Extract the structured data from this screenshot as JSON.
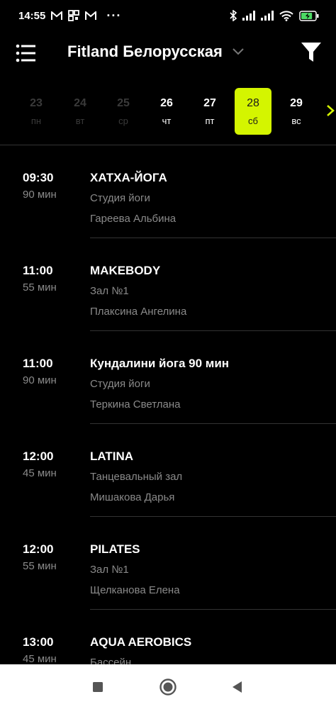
{
  "status_bar": {
    "time": "14:55",
    "left_icons": [
      "gmail-icon",
      "qr-grid-icon",
      "gmail-icon"
    ],
    "more": "···",
    "battery_level_percent": 80
  },
  "header": {
    "club_name": "Fitland Белорусская",
    "icons": {
      "menu": "menu-icon",
      "dropdown": "chevron-down-icon",
      "filter": "filter-icon"
    }
  },
  "dates": [
    {
      "day": "23",
      "dow": "пн",
      "state": "past"
    },
    {
      "day": "24",
      "dow": "вт",
      "state": "past"
    },
    {
      "day": "25",
      "dow": "ср",
      "state": "past"
    },
    {
      "day": "26",
      "dow": "чт",
      "state": "future"
    },
    {
      "day": "27",
      "dow": "пт",
      "state": "future"
    },
    {
      "day": "28",
      "dow": "сб",
      "state": "active"
    },
    {
      "day": "29",
      "dow": "вс",
      "state": "future"
    }
  ],
  "colors": {
    "accent": "#d4f500",
    "background": "#000000",
    "text_primary": "#ffffff",
    "text_secondary": "#8a8a8a",
    "past_date": "#3a3a3a",
    "divider": "#333333"
  },
  "sessions": [
    {
      "time": "09:30",
      "duration": "90 мин",
      "name": "ХАТХА-ЙОГА",
      "room": "Студия йоги",
      "trainer": "Гареева  Альбина"
    },
    {
      "time": "11:00",
      "duration": "55 мин",
      "name": "MAKEBODY",
      "room": "Зал №1",
      "trainer": "Плаксина Ангелина"
    },
    {
      "time": "11:00",
      "duration": "90 мин",
      "name": "Кундалини йога 90 мин",
      "room": "Студия йоги",
      "trainer": "Теркина Светлана"
    },
    {
      "time": "12:00",
      "duration": "45 мин",
      "name": "LATINA",
      "room": "Танцевальный зал",
      "trainer": "Мишакова Дарья"
    },
    {
      "time": "12:00",
      "duration": "55 мин",
      "name": "PILATES",
      "room": "Зал №1",
      "trainer": "Щелканова Елена"
    },
    {
      "time": "13:00",
      "duration": "45 мин",
      "name": "AQUA AEROBICS",
      "room": "Бассейн",
      "trainer": ""
    }
  ],
  "nav_bar": {
    "buttons": [
      "recents-square-icon",
      "home-circle-icon",
      "back-triangle-icon"
    ]
  }
}
